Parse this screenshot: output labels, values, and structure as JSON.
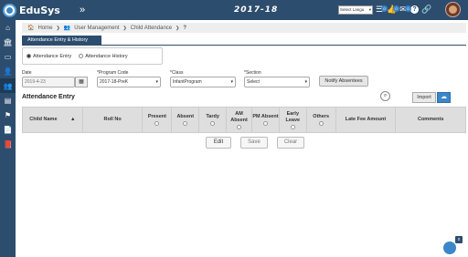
{
  "app": {
    "name": "EduSys",
    "collapse_glyph": "»",
    "year": "2017-18",
    "language": "Select Langu"
  },
  "top_icons": [
    {
      "icon": "list-icon",
      "glyph": "☰",
      "badge": "0"
    },
    {
      "icon": "thumbs-up-icon",
      "glyph": "👍",
      "badge": "0"
    },
    {
      "icon": "mail-icon",
      "glyph": "✉",
      "badge": "0"
    },
    {
      "icon": "help-icon",
      "glyph": "?"
    },
    {
      "icon": "link-icon",
      "glyph": "🔗"
    }
  ],
  "sidebar": [
    {
      "icon": "home-icon",
      "glyph": "⌂"
    },
    {
      "icon": "institution-icon",
      "glyph": "🏛"
    },
    {
      "icon": "monitor-icon",
      "glyph": "▭"
    },
    {
      "icon": "user-icon",
      "glyph": "👤"
    },
    {
      "icon": "user-management-icon",
      "glyph": "👥"
    },
    {
      "icon": "id-card-icon",
      "glyph": "▤"
    },
    {
      "icon": "flag-icon",
      "glyph": "⚑"
    },
    {
      "icon": "document-icon",
      "glyph": "📄"
    },
    {
      "icon": "book-icon",
      "glyph": "📕"
    }
  ],
  "breadcrumb": {
    "home": "Home",
    "user_management": "User Management",
    "child_attendance": "Child Attendance",
    "help": "?"
  },
  "tab": {
    "label": "Attendance Entry & History"
  },
  "radios": {
    "entry": "Attendance Entry",
    "history": "Attendance History",
    "selected": "entry"
  },
  "filters": {
    "date_label": "Date",
    "date_value": "2019-4-23",
    "program_label": "*Program Code",
    "program_value": "2017-18-PreK",
    "class_label": "*Class",
    "class_value": "InfantProgram",
    "section_label": "*Section",
    "section_value": "Select"
  },
  "notify_label": "Notify Absentees",
  "section_title": "Attendance Entry",
  "import_label": "Import",
  "columns": [
    {
      "label": "Child Name",
      "sort": "▲"
    },
    {
      "label": "Roll No"
    },
    {
      "label": "Present",
      "radio": true
    },
    {
      "label": "Absent",
      "radio": true
    },
    {
      "label": "Tardy",
      "radio": true
    },
    {
      "label": "AM Absent",
      "radio": true
    },
    {
      "label": "PM Absent",
      "radio": true
    },
    {
      "label": "Early Leave",
      "radio": true
    },
    {
      "label": "Others",
      "radio": true
    },
    {
      "label": "Late Fee Amount"
    },
    {
      "label": "Comments"
    }
  ],
  "actions": {
    "edit": "Edit",
    "save": "Save",
    "clear": "Clear"
  },
  "chat_badge": "0"
}
